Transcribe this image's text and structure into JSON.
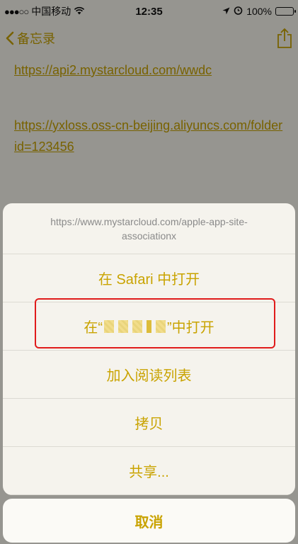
{
  "status_bar": {
    "carrier": "中国移动",
    "time": "12:35",
    "battery_percent": "100%"
  },
  "nav": {
    "back_label": "备忘录"
  },
  "note": {
    "link1": "https://api2.mystarcloud.com/wwdc",
    "link2": "https://yxloss.oss-cn-beijing.aliyuncs.com/folderid=123456"
  },
  "action_sheet": {
    "header_url": "https://www.mystarcloud.com/apple-app-site-associationx",
    "items": [
      {
        "label": "在 Safari 中打开"
      },
      {
        "label_prefix": "在“",
        "label_suffix": "”中打开"
      },
      {
        "label": "加入阅读列表"
      },
      {
        "label": "拷贝"
      },
      {
        "label": "共享..."
      }
    ],
    "cancel_label": "取消"
  },
  "colors": {
    "accent": "#c9a300",
    "highlight_border": "#e01b1b"
  }
}
